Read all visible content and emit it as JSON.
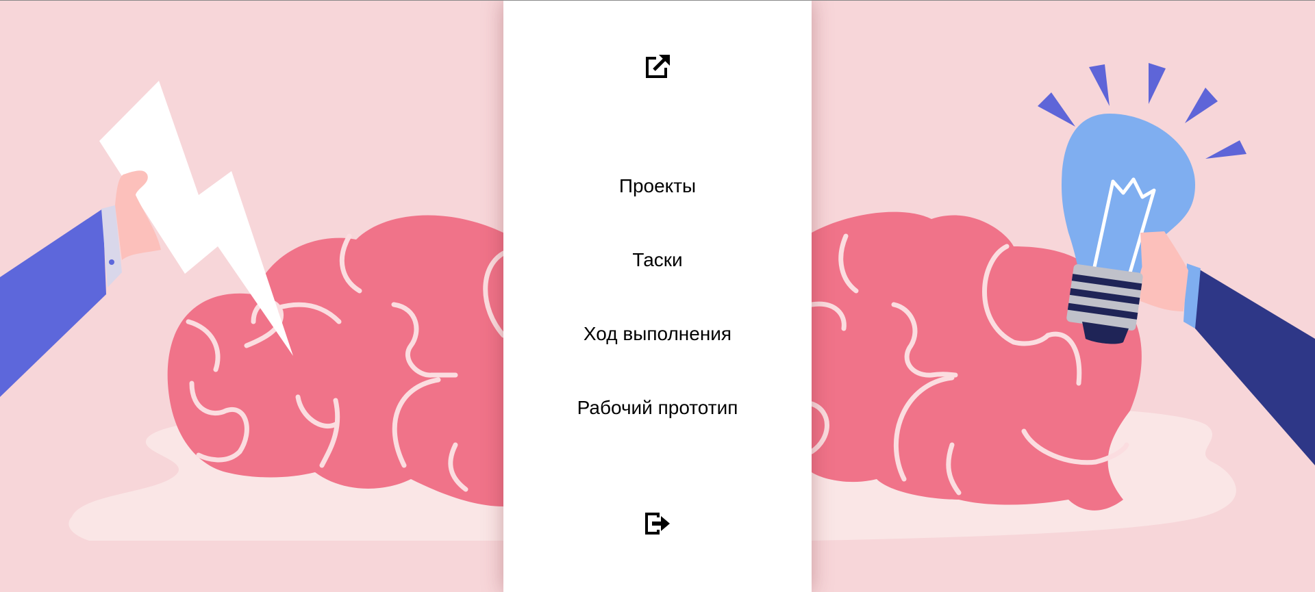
{
  "menu": {
    "items": [
      {
        "label": "Проекты"
      },
      {
        "label": "Таски"
      },
      {
        "label": "Ход выполнения"
      },
      {
        "label": "Рабочий прототип"
      }
    ]
  },
  "icons": {
    "top": "open-external-icon",
    "bottom": "logout-icon"
  },
  "colors": {
    "background": "#f7d6d9",
    "brain": "#f07389",
    "brain_lines": "#fbdde0",
    "panel": "#ffffff",
    "sleeve_left": "#5d67db",
    "sleeve_right": "#2e3787",
    "bulb": "#7faef0",
    "rays": "#5e65d8"
  }
}
